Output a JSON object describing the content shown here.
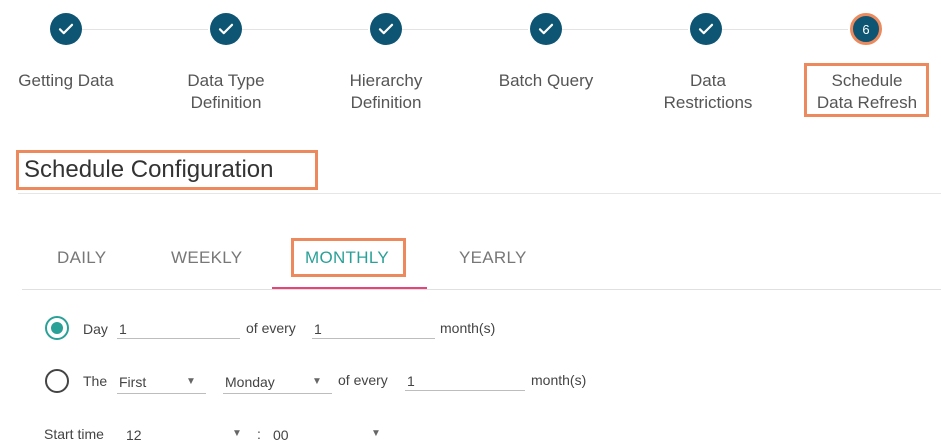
{
  "stepper": {
    "steps": [
      {
        "label": "Getting Data",
        "state": "done"
      },
      {
        "label": "Data Type\nDefinition",
        "state": "done"
      },
      {
        "label": "Hierarchy\nDefinition",
        "state": "done"
      },
      {
        "label": "Batch Query",
        "state": "done"
      },
      {
        "label": "Data\nRestrictions",
        "state": "done"
      },
      {
        "label": "Schedule\nData Refresh",
        "state": "current",
        "number": "6"
      }
    ]
  },
  "section": {
    "title": "Schedule Configuration"
  },
  "tabs": [
    {
      "label": "DAILY"
    },
    {
      "label": "WEEKLY"
    },
    {
      "label": "MONTHLY",
      "active": true
    },
    {
      "label": "YEARLY"
    }
  ],
  "form": {
    "option_day": {
      "label": "Day",
      "day_value": "1",
      "of_every": "of every",
      "every_value": "1",
      "unit": "month(s)"
    },
    "option_the": {
      "label": "The",
      "ordinal_value": "First",
      "weekday_value": "Monday",
      "of_every": "of every",
      "every_value": "1",
      "unit": "month(s)"
    },
    "start_time": {
      "label": "Start time",
      "hour_value": "12",
      "separator": ":",
      "minute_value": "00"
    }
  },
  "colors": {
    "step_done": "#0e5573",
    "highlight": "#ec8a5d",
    "accent_teal": "#2aa198",
    "tab_underline": "#e8447a"
  },
  "icons": {
    "step_done": "check-icon",
    "dropdown": "caret-down-icon"
  }
}
